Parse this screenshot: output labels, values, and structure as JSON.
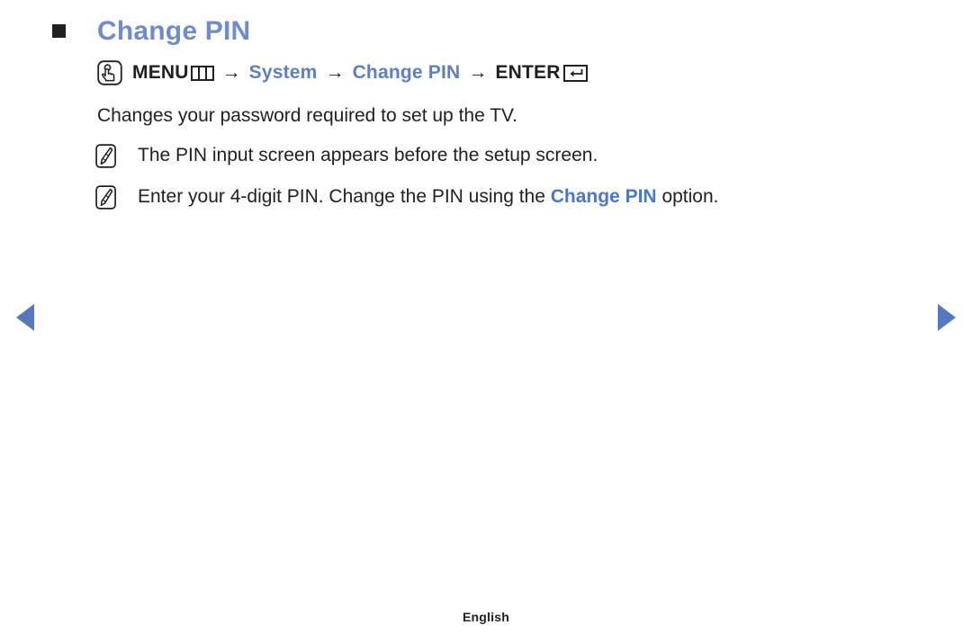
{
  "page": {
    "background_color": "#ffffff",
    "accent_blue": "#6f8dcd",
    "link_blue": "#4a77c8",
    "text_color": "#231f20"
  },
  "heading": {
    "bullet_icon": "black-square-bullet",
    "title": "Change PIN"
  },
  "menu_path": {
    "hand_icon": "hand-press-icon",
    "menu_label": "MENU",
    "menu_icon": "menu-grid-icon",
    "arrow_1": "→",
    "item_1": "System",
    "arrow_2": "→",
    "item_2": "Change PIN",
    "arrow_3": "→",
    "enter_label": "ENTER",
    "enter_icon": "enter-return-icon"
  },
  "description": "Changes your password required to set up the TV.",
  "notes": [
    {
      "icon": "note-pencil-icon",
      "text_before": "The PIN input screen appears before the setup screen.",
      "highlight": "",
      "text_after": ""
    },
    {
      "icon": "note-pencil-icon",
      "text_before": "Enter your 4-digit PIN. Change the PIN using the ",
      "highlight": "Change PIN",
      "text_after": " option."
    }
  ],
  "navigation": {
    "prev_label": "◀",
    "next_label": "▶"
  },
  "footer": {
    "language": "English"
  }
}
